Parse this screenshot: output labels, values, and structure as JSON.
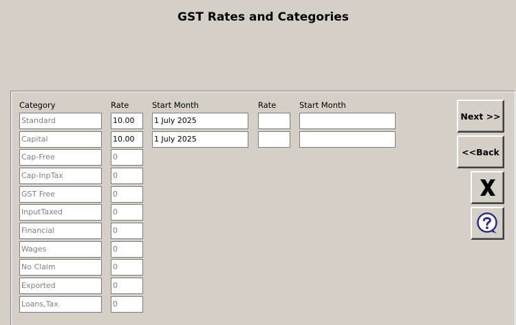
{
  "title": "GST Rates and Categories",
  "headers": {
    "category": "Category",
    "rate": "Rate",
    "start_month": "Start Month",
    "rate2": "Rate",
    "start_month2": "Start Month"
  },
  "rows": [
    {
      "category": "Standard",
      "rate": "10.00",
      "start": "1 July 2025",
      "rate2": "",
      "start2": ""
    },
    {
      "category": "Capital",
      "rate": "10.00",
      "start": "1 July 2025",
      "rate2": "",
      "start2": ""
    },
    {
      "category": "Cap-Free",
      "rate": "0"
    },
    {
      "category": "Cap-InpTax",
      "rate": "0"
    },
    {
      "category": "GST Free",
      "rate": "0"
    },
    {
      "category": "InputTaxed",
      "rate": "0"
    },
    {
      "category": "Financial",
      "rate": "0"
    },
    {
      "category": "Wages",
      "rate": "0"
    },
    {
      "category": "No Claim",
      "rate": "0"
    },
    {
      "category": "Exported",
      "rate": "0"
    },
    {
      "category": "Loans,Tax",
      "rate": "0"
    }
  ],
  "buttons": {
    "next": "Next >>",
    "back": "<<Back"
  },
  "icons": {
    "close": "close-icon",
    "help": "help-icon"
  },
  "colors": {
    "background": "#d4d0c8",
    "help_icon": "#2b2b8c"
  }
}
